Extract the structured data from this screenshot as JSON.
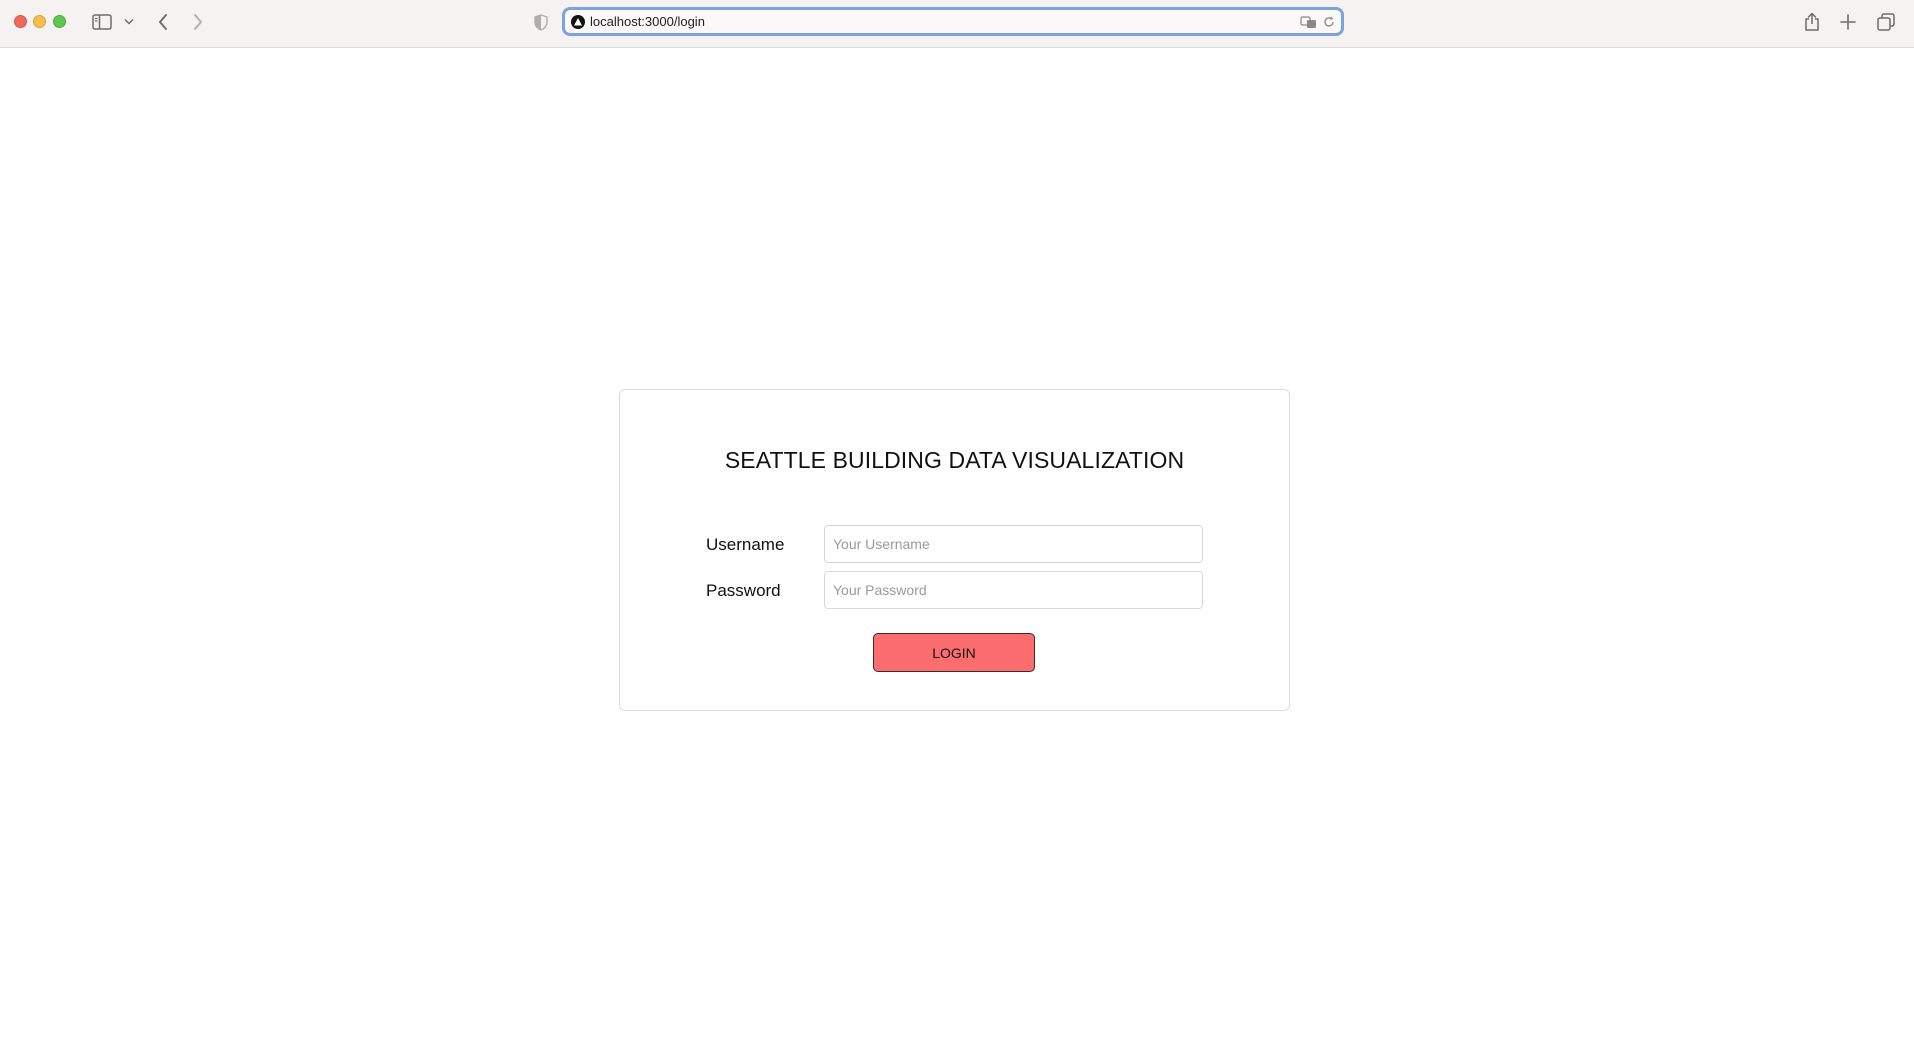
{
  "browser": {
    "url": "localhost:3000/login"
  },
  "login": {
    "title": "SEATTLE BUILDING DATA VISUALIZATION",
    "username_label": "Username",
    "username_placeholder": "Your Username",
    "username_value": "",
    "password_label": "Password",
    "password_placeholder": "Your Password",
    "password_value": "",
    "submit_label": "LOGIN"
  },
  "colors": {
    "button_fill": "#fc6d6f",
    "url_focus_ring": "#7aa3e0",
    "toolbar_bg": "#f6f2f1"
  },
  "icons": {
    "toolbar": [
      "sidebar-icon",
      "chevron-down-icon",
      "back-arrow-icon",
      "forward-arrow-icon",
      "shield-icon",
      "share-icon",
      "plus-icon",
      "tabs-overview-icon"
    ],
    "url_bar": [
      "site-favicon-icon",
      "translate-icon",
      "reload-icon"
    ]
  }
}
